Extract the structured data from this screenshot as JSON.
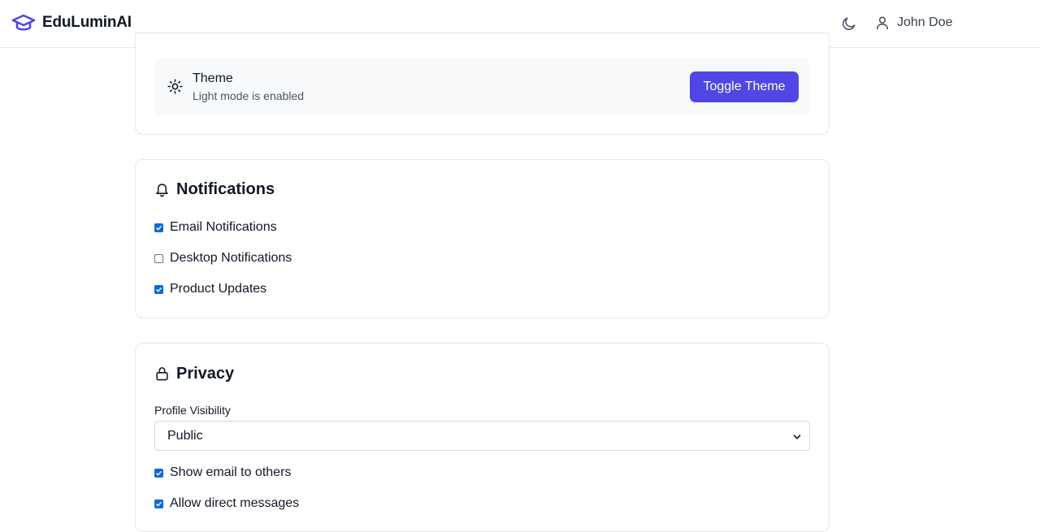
{
  "header": {
    "brand_name": "EduLuminAI",
    "brand_icon": "graduation-cap-icon",
    "theme_icon": "moon-icon",
    "user_icon": "user-icon",
    "user_name": "John Doe"
  },
  "theme": {
    "icon": "sun-icon",
    "title": "Theme",
    "subtitle": "Light mode is enabled",
    "button_label": "Toggle Theme"
  },
  "notifications": {
    "icon": "bell-icon",
    "title": "Notifications",
    "items": [
      {
        "label": "Email Notifications",
        "checked": true
      },
      {
        "label": "Desktop Notifications",
        "checked": false
      },
      {
        "label": "Product Updates",
        "checked": true
      }
    ]
  },
  "privacy": {
    "icon": "lock-icon",
    "title": "Privacy",
    "visibility_label": "Profile Visibility",
    "visibility_value": "Public",
    "items": [
      {
        "label": "Show email to others",
        "checked": true
      },
      {
        "label": "Allow direct messages",
        "checked": true
      }
    ]
  },
  "colors": {
    "accent": "#4f46e5",
    "checkbox": "#0b6bde",
    "border": "#e5e7eb"
  }
}
